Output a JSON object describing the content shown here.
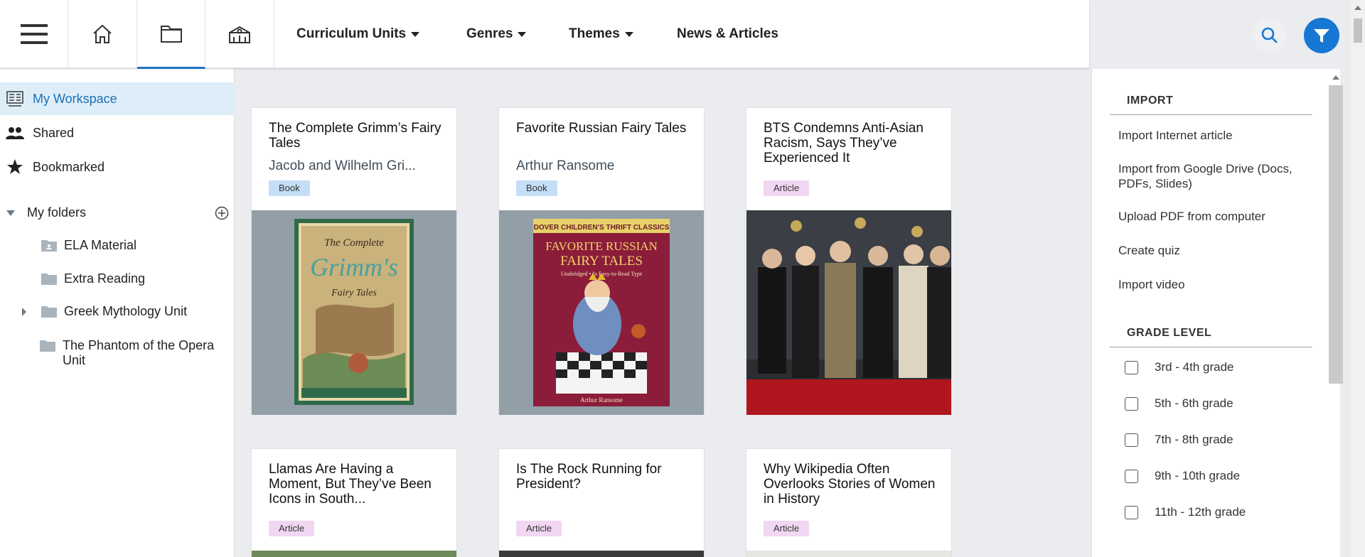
{
  "header": {
    "menus": [
      {
        "label": "Curriculum Units",
        "has_dropdown": true
      },
      {
        "label": "Genres",
        "has_dropdown": true
      },
      {
        "label": "Themes",
        "has_dropdown": true
      },
      {
        "label": "News & Articles",
        "has_dropdown": false
      }
    ],
    "icons": [
      "menu-icon",
      "home-icon",
      "folder-icon",
      "library-icon",
      "search-icon",
      "filter-icon"
    ],
    "accent_color": "#1877d2"
  },
  "sidebar": {
    "items": [
      {
        "label": "My Workspace",
        "icon": "workspace-icon",
        "active": true
      },
      {
        "label": "Shared",
        "icon": "people-icon",
        "active": false
      },
      {
        "label": "Bookmarked",
        "icon": "star-icon",
        "active": false
      }
    ],
    "folders_heading": "My folders",
    "folders": [
      {
        "label": "ELA Material",
        "expandable": false
      },
      {
        "label": "Extra Reading",
        "expandable": false
      },
      {
        "label": "Greek Mythology Unit",
        "expandable": true
      },
      {
        "label": "The Phantom of the Opera Unit",
        "expandable": false
      }
    ]
  },
  "cards": [
    {
      "title": "The Complete Grimm’s Fairy Tales",
      "author": "Jacob and Wilhelm Gri...",
      "type": "Book"
    },
    {
      "title": "Favorite Russian Fairy Tales",
      "author": "Arthur Ransome",
      "type": "Book"
    },
    {
      "title": "BTS Condemns Anti-Asian Racism, Says They’ve Experienced It",
      "author": "",
      "type": "Article"
    },
    {
      "title": "Llamas Are Having a Moment, But They’ve Been Icons in South...",
      "author": "",
      "type": "Article"
    },
    {
      "title": "Is The Rock Running for President?",
      "author": "",
      "type": "Article"
    },
    {
      "title": "Why Wikipedia Often Overlooks Stories of Women in History",
      "author": "",
      "type": "Article"
    }
  ],
  "covers": {
    "grimm": {
      "line1": "The Complete",
      "line2": "Grimm's",
      "line3": "Fairy Tales"
    },
    "russian": {
      "series": "DOVER CHILDREN'S THRIFT CLASSICS",
      "title1": "FAVORITE RUSSIAN",
      "title2": "FAIRY TALES",
      "subtitle": "Unabridged • In Easy-to-Read Type",
      "author": "Arthur Ransome"
    }
  },
  "right_panel": {
    "import_heading": "IMPORT",
    "import_items": [
      "Import Internet article",
      "Import from Google Drive (Docs, PDFs, Slides)",
      "Upload PDF from computer",
      "Create quiz",
      "Import video"
    ],
    "grade_heading": "GRADE LEVEL",
    "grades": [
      {
        "label": "3rd - 4th grade",
        "checked": false
      },
      {
        "label": "5th - 6th grade",
        "checked": false
      },
      {
        "label": "7th - 8th grade",
        "checked": false
      },
      {
        "label": "9th - 10th grade",
        "checked": false
      },
      {
        "label": "11th - 12th grade",
        "checked": false
      }
    ]
  }
}
